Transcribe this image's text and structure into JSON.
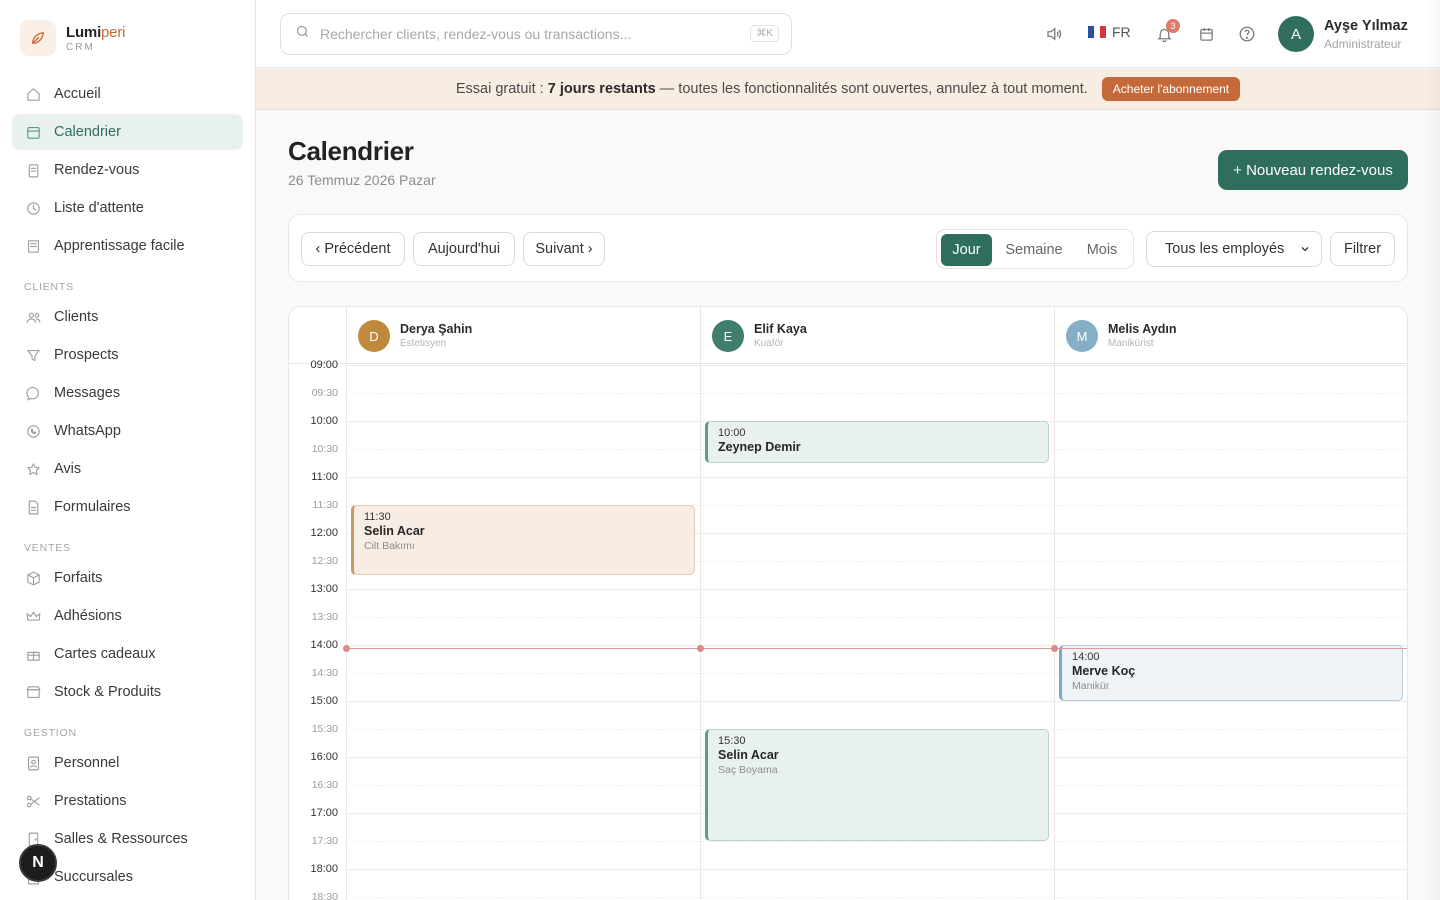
{
  "brand": {
    "name_a": "Lumi",
    "name_b": "peri",
    "sub": "CRM"
  },
  "sidebar": {
    "items": [
      {
        "label": "Accueil",
        "icon": "home-icon"
      },
      {
        "label": "Calendrier",
        "icon": "calendar-icon",
        "active": true
      },
      {
        "label": "Rendez-vous",
        "icon": "clipboard-icon"
      },
      {
        "label": "Liste d'attente",
        "icon": "clock-icon"
      },
      {
        "label": "Apprentissage facile",
        "icon": "book-icon"
      }
    ],
    "sections": [
      {
        "title": "CLIENTS",
        "items": [
          {
            "label": "Clients",
            "icon": "users-icon"
          },
          {
            "label": "Prospects",
            "icon": "filter-icon"
          },
          {
            "label": "Messages",
            "icon": "message-icon"
          },
          {
            "label": "WhatsApp",
            "icon": "whatsapp-icon"
          },
          {
            "label": "Avis",
            "icon": "star-icon"
          },
          {
            "label": "Formulaires",
            "icon": "document-icon"
          }
        ]
      },
      {
        "title": "VENTES",
        "items": [
          {
            "label": "Forfaits",
            "icon": "package-icon"
          },
          {
            "label": "Adhésions",
            "icon": "crown-icon"
          },
          {
            "label": "Cartes cadeaux",
            "icon": "gift-icon"
          },
          {
            "label": "Stock & Produits",
            "icon": "box-icon"
          }
        ]
      },
      {
        "title": "GESTION",
        "items": [
          {
            "label": "Personnel",
            "icon": "id-badge-icon"
          },
          {
            "label": "Prestations",
            "icon": "scissors-icon"
          },
          {
            "label": "Salles & Ressources",
            "icon": "door-icon"
          },
          {
            "label": "Succursales",
            "icon": "building-icon"
          }
        ]
      }
    ],
    "floating_badge": "N"
  },
  "topbar": {
    "search_placeholder": "Rechercher clients, rendez-vous ou transactions...",
    "search_shortcut": "⌘K",
    "language": "FR",
    "notifications_count": "3",
    "user": {
      "initial": "A",
      "name": "Ayşe Yılmaz",
      "role": "Administrateur"
    }
  },
  "banner": {
    "lead": "Essai gratuit : ",
    "highlight": "7 jours restants",
    "rest": " — toutes les fonctionnalités sont ouvertes, annulez à tout moment.",
    "button": "Acheter l'abonnement"
  },
  "page": {
    "title": "Calendrier",
    "date": "26 Temmuz 2026 Pazar",
    "new_button": "+ Nouveau rendez-vous"
  },
  "toolbar": {
    "prev": "‹ Précédent",
    "today": "Aujourd'hui",
    "next": "Suivant ›",
    "views": [
      "Jour",
      "Semaine",
      "Mois"
    ],
    "active_view": "Jour",
    "employee_filter": "Tous les employés",
    "filter": "Filtrer"
  },
  "calendar": {
    "time_labels": [
      "09:00",
      "09:30",
      "10:00",
      "10:30",
      "11:00",
      "11:30",
      "12:00",
      "12:30",
      "13:00",
      "13:30",
      "14:00",
      "14:30",
      "15:00",
      "15:30",
      "16:00",
      "16:30",
      "17:00",
      "17:30",
      "18:00",
      "18:30"
    ],
    "staff": [
      {
        "initial": "D",
        "name": "Derya Şahin",
        "role": "Estetisyen",
        "color": "#c08a3e"
      },
      {
        "initial": "E",
        "name": "Elif Kaya",
        "role": "Kuaför",
        "color": "#3f7d6c"
      },
      {
        "initial": "M",
        "name": "Melis Aydın",
        "role": "Manikürist",
        "color": "#86aec6"
      }
    ],
    "appointments": [
      {
        "staff": 1,
        "time": "10:00",
        "client": "Zeynep Demir",
        "service": "",
        "start": 10.0,
        "end": 10.75,
        "style": "green"
      },
      {
        "staff": 0,
        "time": "11:30",
        "client": "Selin Acar",
        "service": "Cilt Bakımı",
        "start": 11.5,
        "end": 12.75,
        "style": "tan"
      },
      {
        "staff": 2,
        "time": "14:00",
        "client": "Merve Koç",
        "service": "Manikür",
        "start": 14.0,
        "end": 15.0,
        "style": "blue"
      },
      {
        "staff": 1,
        "time": "15:30",
        "client": "Selin Acar",
        "service": "Saç Boyama",
        "start": 15.5,
        "end": 17.5,
        "style": "green"
      }
    ],
    "current_time": "14:05"
  }
}
